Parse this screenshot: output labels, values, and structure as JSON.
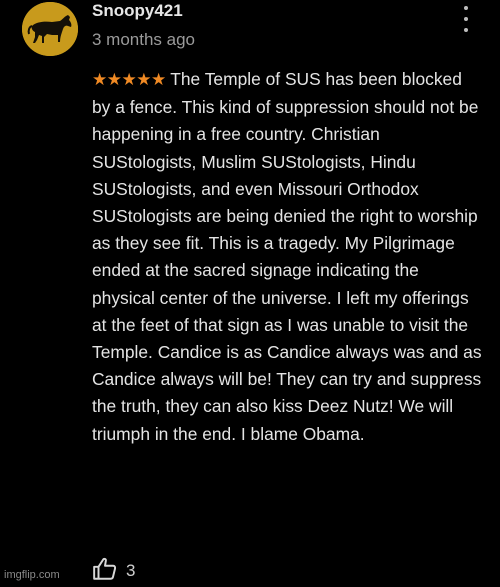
{
  "comment": {
    "author": "Snoopy421",
    "time_ago": "3 months ago",
    "rating_stars": "★★★★★",
    "rating": 5,
    "text": "The Temple of SUS has been blocked by a fence. This kind of suppression should not be happening in a free country. Christian SUStologists, Muslim SUStologists, Hindu SUStologists, and even Missouri Orthodox SUStologists are being denied the right to worship as they see fit. This is a tragedy. My Pilgrimage ended at the sacred signage indicating the physical center of the universe. I left my offerings at the feet of that sign as I was unable to visit the Temple. Candice is as Candice always was and as Candice always will be! They can try and suppress the truth, they can also kiss Deez Nutz! We will triumph in the end. I blame Obama.",
    "likes": "3",
    "avatar_icon": "horse-silhouette-icon",
    "more_icon": "more-vertical-icon",
    "like_icon": "thumbs-up-icon"
  },
  "watermark": "imgflip.com",
  "colors": {
    "background": "#000000",
    "star": "#f08a24",
    "avatar_bg": "#c89a1c",
    "text": "#e4e4e4",
    "muted": "#9a9a9a"
  }
}
